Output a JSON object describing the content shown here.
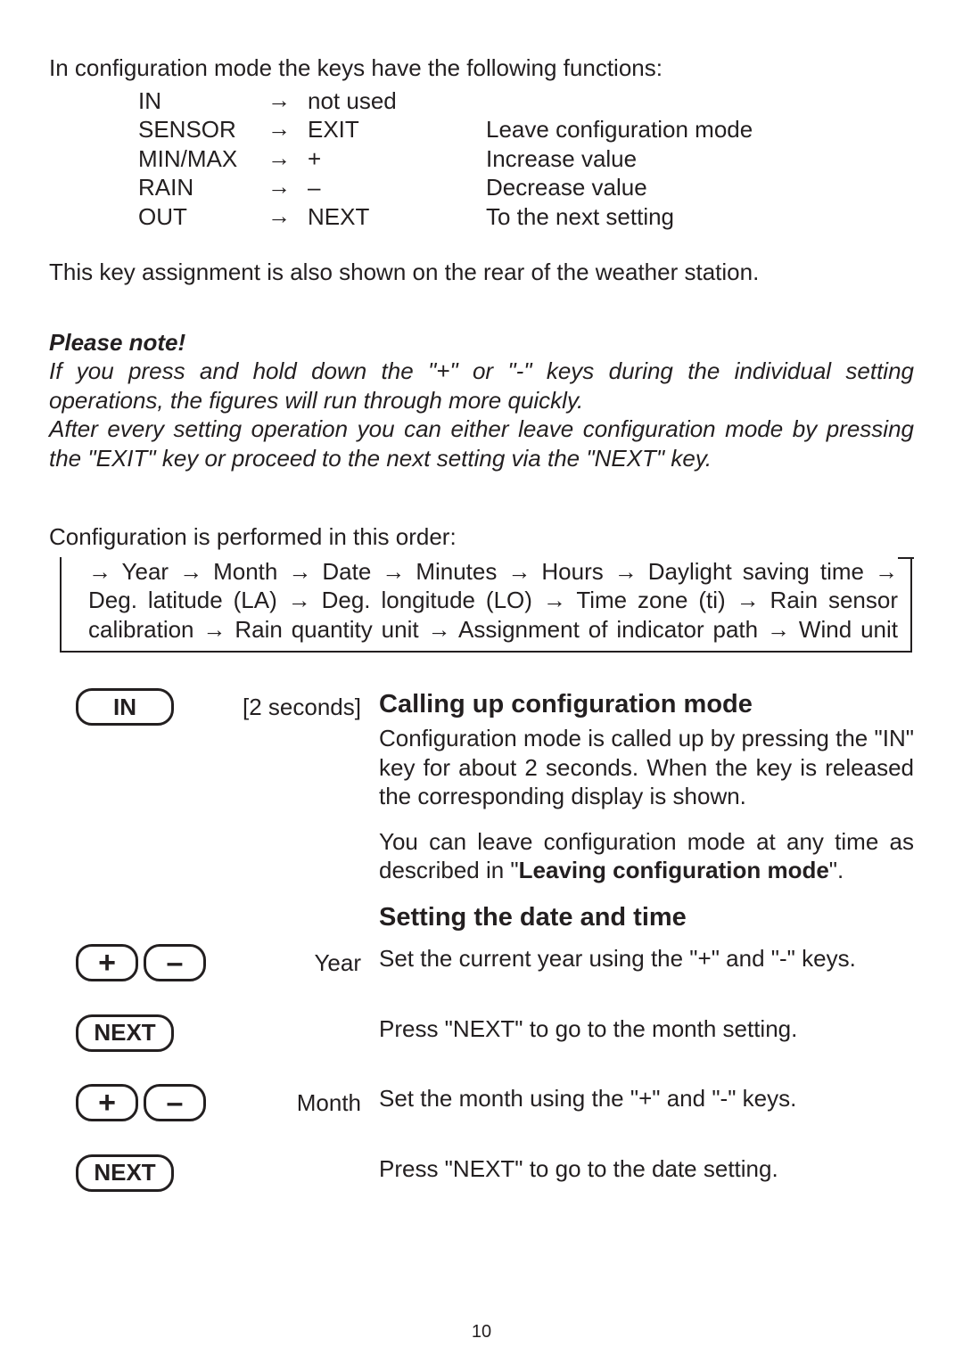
{
  "intro": "In configuration mode the keys have the following functions:",
  "key_table": [
    {
      "key": "IN",
      "func": "not used",
      "desc": ""
    },
    {
      "key": "SENSOR",
      "func": "EXIT",
      "desc": "Leave configuration mode"
    },
    {
      "key": "MIN/MAX",
      "func": "+",
      "desc": "Increase value"
    },
    {
      "key": "RAIN",
      "func": "–",
      "desc": "Decrease value"
    },
    {
      "key": "OUT",
      "func": "NEXT",
      "desc": "To the next setting"
    }
  ],
  "arrow_glyph": "→",
  "rear_note": "This key assignment is also shown on the rear of the weather station.",
  "please_note_heading": "Please note!",
  "please_note_body1": "If you press and hold down the \"+\" or \"-\" keys during the individual setting operations, the figures will run through more quickly.",
  "please_note_body2": "After every setting operation you can either leave configuration mode by pressing the \"EXIT\" key or proceed to the next setting via the \"NEXT\" key.",
  "config_order_intro": "Configuration is performed in this order:",
  "flow_line1": "→ Year → Month → Date → Minutes → Hours → Daylight saving time →",
  "flow_line2": "Deg. latitude (LA) → Deg. longitude (LO) → Time zone (ti) →  Rain sensor",
  "flow_line3": "calibration → Rain quantity unit → Assignment of indicator path → Wind unit",
  "heading_calling": "Calling up configuration mode",
  "calling_p1": "Configuration mode is called up by pressing the \"IN\" key for about 2 seconds. When the key is released the corresponding display is shown.",
  "calling_p2_pre": "You can leave configuration mode at any time as described in \"",
  "calling_p2_bold": "Leaving configuration mode",
  "calling_p2_post": "\".",
  "heading_datetime": "Setting the date and time",
  "buttons": {
    "in": "IN",
    "plus": "+",
    "minus": "–",
    "next": "NEXT"
  },
  "labels": {
    "two_sec": "[2 seconds]",
    "year": "Year",
    "month": "Month"
  },
  "year_text": "Set the current year using the \"+\" and \"-\" keys.",
  "next_month_text": "Press \"NEXT\" to go to the month setting.",
  "month_text": "Set the month using the \"+\" and \"-\" keys.",
  "next_date_text": "Press \"NEXT\" to go to the date setting.",
  "page_number": "10"
}
